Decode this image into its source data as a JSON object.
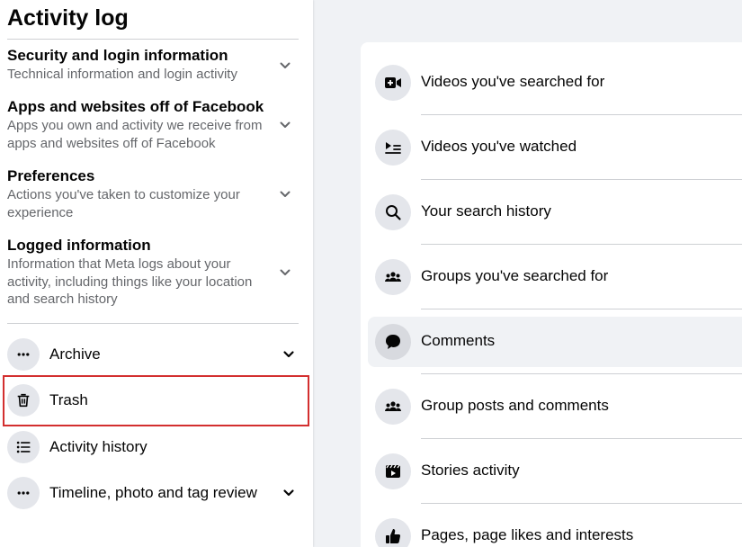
{
  "page": {
    "title": "Activity log"
  },
  "sections": [
    {
      "title": "Security and login information",
      "desc": "Technical information and login activity"
    },
    {
      "title": "Apps and websites off of Facebook",
      "desc": "Apps you own and activity we receive from apps and websites off of Facebook"
    },
    {
      "title": "Preferences",
      "desc": "Actions you've taken to customize your experience"
    },
    {
      "title": "Logged information",
      "desc": "Information that Meta logs about your activity, including things like your location and search history"
    }
  ],
  "nav": [
    {
      "label": "Archive",
      "icon": "more-dots-icon"
    },
    {
      "label": "Trash",
      "icon": "trash-icon"
    },
    {
      "label": "Activity history",
      "icon": "list-icon"
    },
    {
      "label": "Timeline, photo and tag review",
      "icon": "more-dots-icon"
    }
  ],
  "activity_items": [
    {
      "label": "Videos you've searched for",
      "icon": "video-search-icon"
    },
    {
      "label": "Videos you've watched",
      "icon": "video-watched-icon"
    },
    {
      "label": "Your search history",
      "icon": "search-icon"
    },
    {
      "label": "Groups you've searched for",
      "icon": "groups-icon"
    },
    {
      "label": "Comments",
      "icon": "comment-icon"
    },
    {
      "label": "Group posts and comments",
      "icon": "groups-icon"
    },
    {
      "label": "Stories activity",
      "icon": "clapperboard-icon"
    },
    {
      "label": "Pages, page likes and interests",
      "icon": "thumbs-up-icon"
    }
  ],
  "colors": {
    "highlight_border": "#d32f2f",
    "secondary_text": "#65676b",
    "icon_bg": "#e4e6eb",
    "page_bg": "#f0f2f5"
  }
}
